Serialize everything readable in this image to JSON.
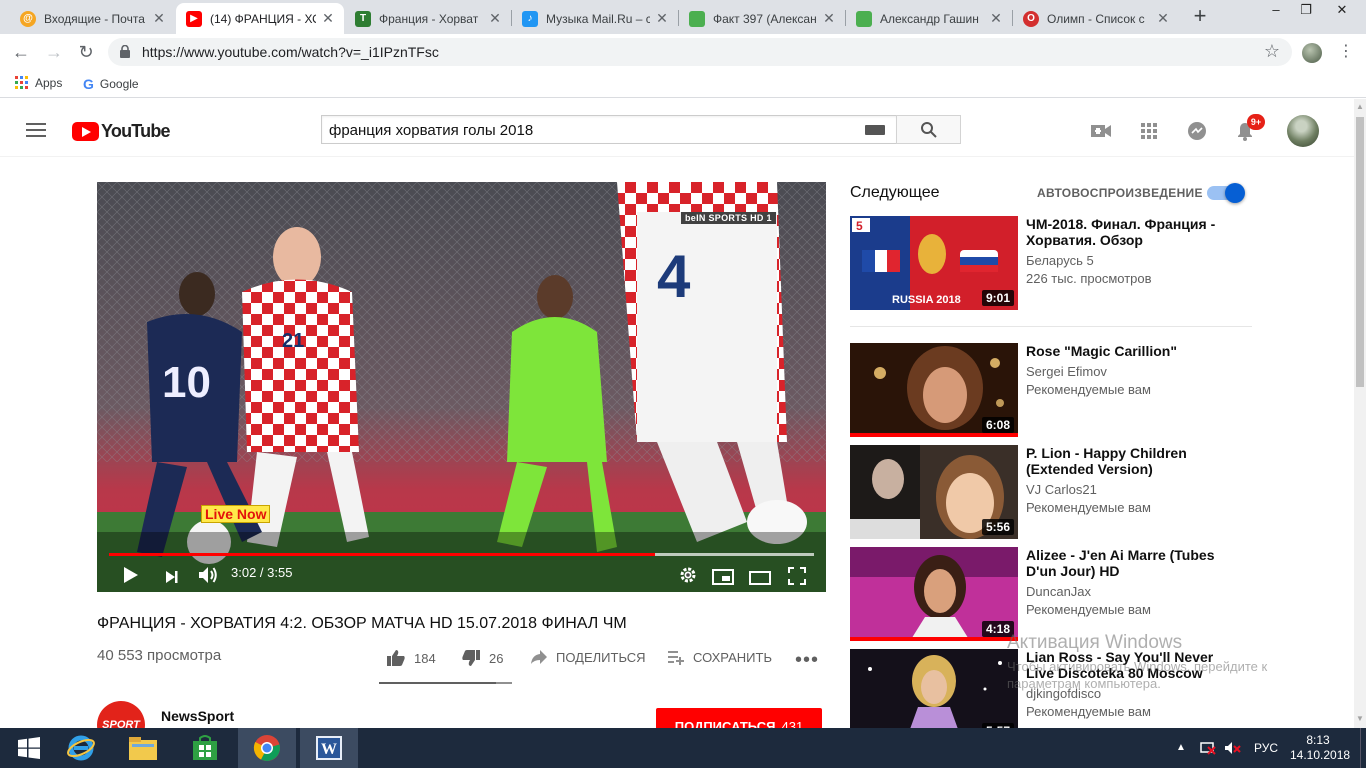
{
  "browser": {
    "tabs": [
      {
        "title": "Входящие - Почта",
        "icon": "mail-ru-icon",
        "color": "#f5a623"
      },
      {
        "title": "(14) ФРАНЦИЯ - ХО",
        "icon": "youtube-icon",
        "color": "#ff0000"
      },
      {
        "title": "Франция - Хорват",
        "icon": "sports-icon",
        "color": "#2e7d32"
      },
      {
        "title": "Музыка Mail.Ru – с",
        "icon": "music-icon",
        "color": "#2196f3"
      },
      {
        "title": "Факт 397 (Алексан",
        "icon": "green-square-icon",
        "color": "#4caf50"
      },
      {
        "title": "Александр Гашин",
        "icon": "green-square-icon",
        "color": "#4caf50"
      },
      {
        "title": "Олимп - Список с",
        "icon": "olimp-icon",
        "color": "#d32f2f"
      }
    ],
    "url": "https://www.youtube.com/watch?v=_i1IPznTFsc",
    "bookmarks": [
      {
        "label": "Apps",
        "icon": "apps-grid-icon"
      },
      {
        "label": "Google",
        "icon": "google-icon"
      }
    ]
  },
  "youtube": {
    "logo_text": "YouTube",
    "search_query": "франция хорватия голы 2018",
    "notifications_badge": "9+",
    "player": {
      "current_time": "3:02",
      "duration": "3:55",
      "progress_fraction": 0.774,
      "buffered_fraction": 1.0,
      "overlay_text": "Live Now",
      "channel_logo_text": "beIN SPORTS HD 1"
    },
    "video": {
      "title": "ФРАНЦИЯ - ХОРВАТИЯ 4:2. ОБЗОР МАТЧА HD 15.07.2018 ФИНАЛ ЧМ",
      "views": "40 553 просмотра",
      "likes": "184",
      "dislikes": "26",
      "like_ratio": 0.876,
      "share_label": "ПОДЕЛИТЬСЯ",
      "save_label": "СОХРАНИТЬ"
    },
    "channel": {
      "name": "NewsSport",
      "avatar_text": "SPORT",
      "subscribe_label": "ПОДПИСАТЬСЯ",
      "subscriber_count": "431"
    },
    "sidebar": {
      "next_label": "Следующее",
      "autoplay_label": "АВТОВОСПРОИЗВЕДЕНИЕ",
      "recommendations": [
        {
          "title": "ЧМ-2018. Финал. Франция - Хорватия. Обзор",
          "channel": "Беларусь 5",
          "meta": "226 тыс. просмотров",
          "duration": "9:01",
          "thumb_text": "RUSSIA 2018",
          "watched": false
        },
        {
          "title": "Rose \"Magic Carillion\"",
          "channel": "Sergei Efimov",
          "meta": "Рекомендуемые вам",
          "duration": "6:08",
          "watched": true
        },
        {
          "title": "P. Lion - Happy Children (Extended Version)",
          "channel": "VJ Carlos21",
          "meta": "Рекомендуемые вам",
          "duration": "5:56",
          "watched": false
        },
        {
          "title": "Alizee - J'en Ai Marre (Tubes D'un Jour) HD",
          "channel": "DuncanJax",
          "meta": "Рекомендуемые вам",
          "duration": "4:18",
          "watched": true
        },
        {
          "title": "Lian Ross - Say You'll Never Live Discoteka 80 Moscow 2014...",
          "channel": "djkingofdisco",
          "meta": "Рекомендуемые вам",
          "duration": "5:57",
          "watched": false
        }
      ]
    }
  },
  "os": {
    "watermark_title": "Активация Windows",
    "watermark_text": "Чтобы активировать Windows, перейдите к параметрам компьютера.",
    "language": "РУС",
    "time": "8:13",
    "date": "14.10.2018"
  }
}
